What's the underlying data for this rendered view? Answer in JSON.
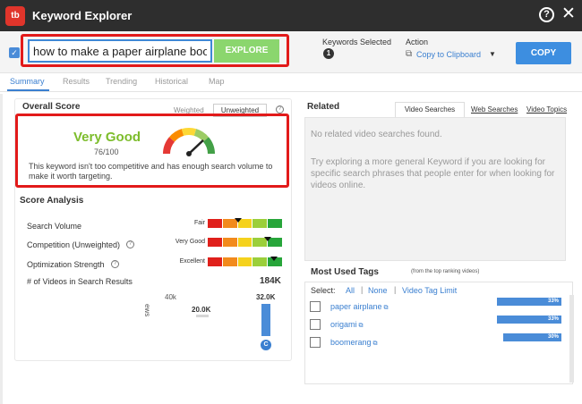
{
  "app": {
    "logo_text": "tb",
    "title": "Keyword Explorer"
  },
  "search": {
    "value": "how to make a paper airplane boo",
    "explore_label": "EXPLORE"
  },
  "keywords_selected": {
    "label": "Keywords Selected",
    "count": "1"
  },
  "action": {
    "label": "Action",
    "clipboard_label": "Copy to Clipboard",
    "copy_label": "COPY"
  },
  "tabs": [
    "Summary",
    "Results",
    "Trending",
    "Historical",
    "Map"
  ],
  "overall_score": {
    "title": "Overall Score",
    "weighted_label": "Weighted",
    "unweighted_label": "Unweighted",
    "rating": "Very Good",
    "score": "76/100",
    "score_value": 76,
    "description": "This keyword isn't too competitive and has enough search volume to make it worth targeting."
  },
  "score_analysis": {
    "title": "Score Analysis",
    "rows": [
      {
        "label": "Search Volume",
        "meter_label": "Fair",
        "level": 0.4
      },
      {
        "label": "Competition (Unweighted)",
        "meter_label": "Very Good",
        "level": 0.8
      },
      {
        "label": "Optimization Strength",
        "meter_label": "Excellent",
        "level": 0.88
      }
    ],
    "videos_label": "# of Videos in Search Results",
    "videos_value": "184K",
    "chart": {
      "label_40k": "40k",
      "label_20k": "20.0K",
      "label_32k": "32.0K",
      "axis_label": "ews",
      "c_badge": "C"
    }
  },
  "related": {
    "title": "Related",
    "tabs": [
      "Video Searches",
      "Web Searches",
      "Video Topics"
    ],
    "empty_message": "No related video searches found.",
    "suggestion": "Try exploring a more general Keyword if you are looking for specific search phrases that people enter for when looking for videos online."
  },
  "tags": {
    "title": "Most Used Tags",
    "subtitle": "(from the top ranking videos)",
    "select_label": "Select:",
    "select_all": "All",
    "select_none": "None",
    "select_limit": "Video Tag Limit",
    "items": [
      {
        "name": "paper airplane",
        "percent": "33%",
        "value": 33
      },
      {
        "name": "origami",
        "percent": "33%",
        "value": 33
      },
      {
        "name": "boomerang",
        "percent": "30%",
        "value": 30
      }
    ]
  },
  "colors": {
    "accent": "#3a7fd0",
    "highlight": "#e21a1a",
    "good": "#7dbd2c"
  }
}
